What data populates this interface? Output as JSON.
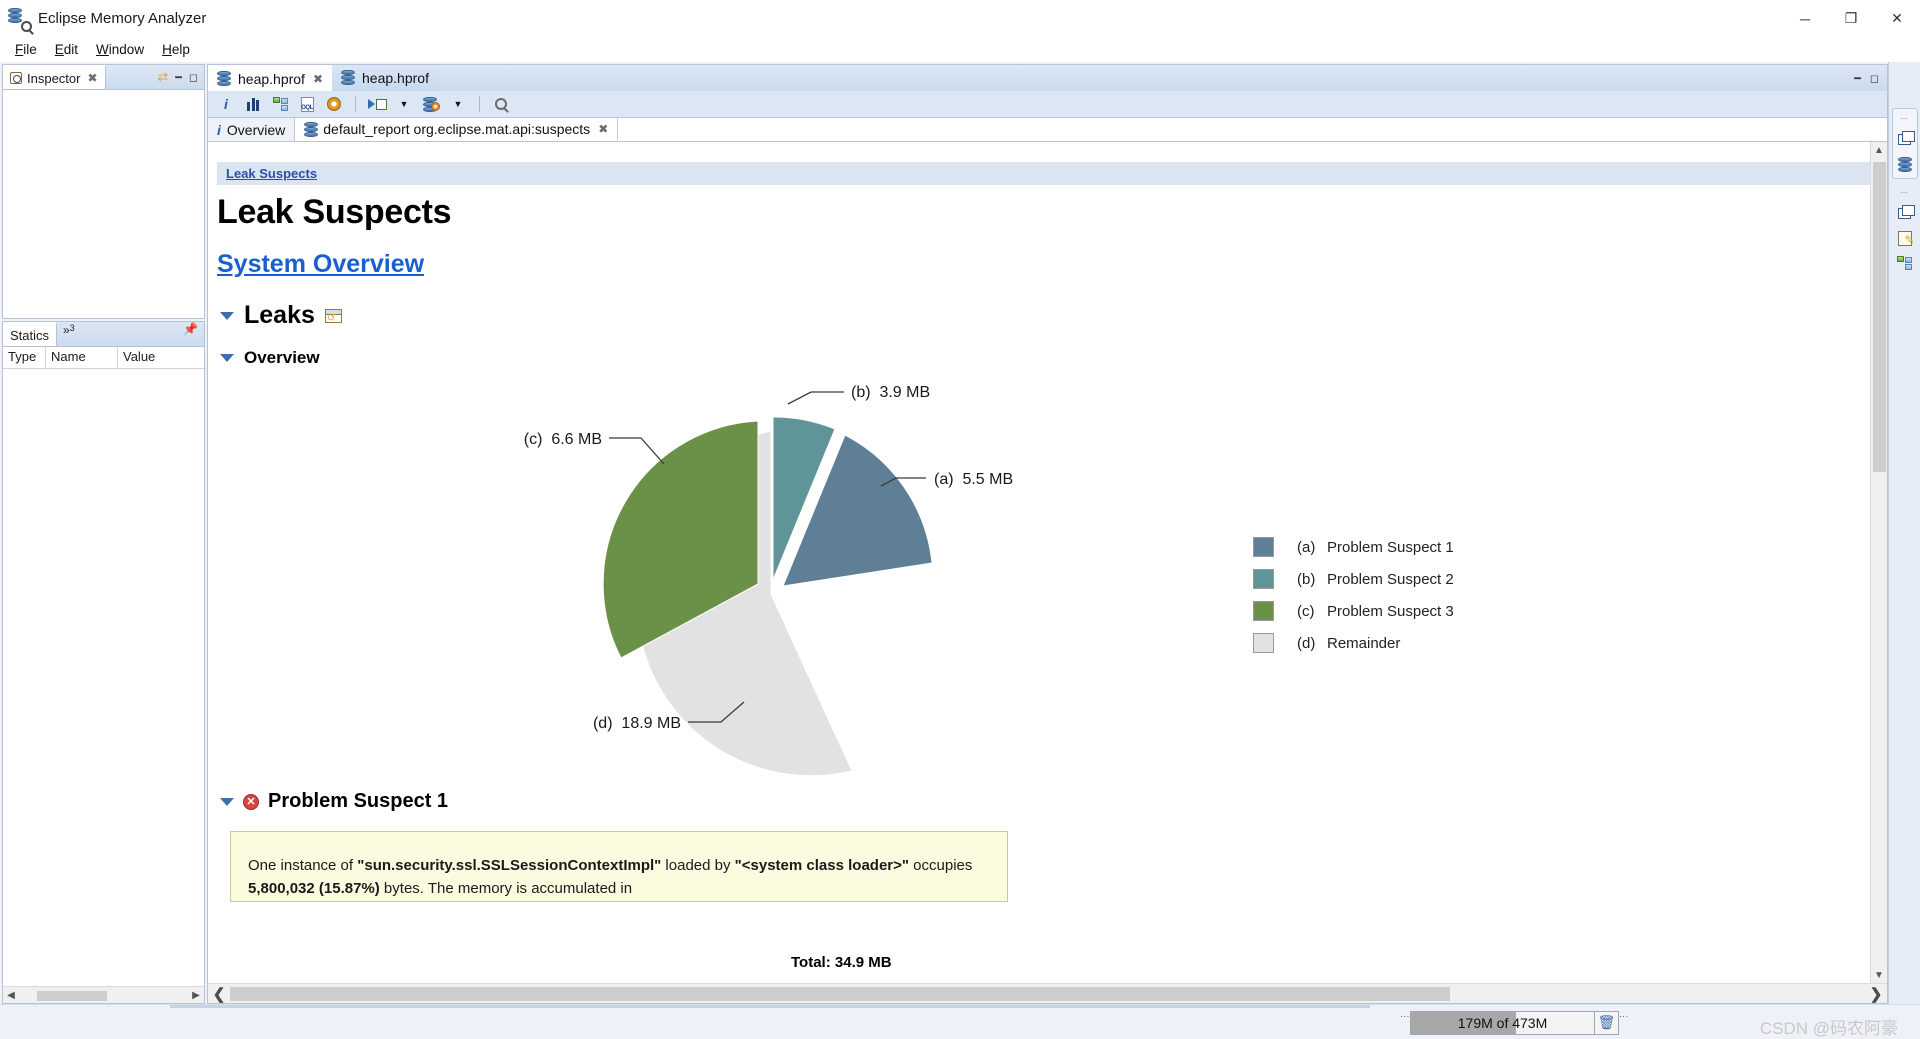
{
  "window": {
    "title": "Eclipse Memory Analyzer",
    "icon": "eclipse-mat-icon",
    "minimize": "─",
    "maximize": "❐",
    "close": "✕"
  },
  "menubar": {
    "items": [
      {
        "label": "File",
        "mnemonic": "F"
      },
      {
        "label": "Edit",
        "mnemonic": "E"
      },
      {
        "label": "Window",
        "mnemonic": "W"
      },
      {
        "label": "Help",
        "mnemonic": "H"
      }
    ]
  },
  "left_panel": {
    "inspector": {
      "tab_label": "Inspector",
      "close_glyph": "✖",
      "sync_icon": "sync-icon",
      "minimize_icon": "minimize-icon",
      "maximize_icon": "maximize-icon"
    },
    "statics": {
      "tab_label": "Statics",
      "more_label": "»",
      "more_count": "3",
      "pin_icon": "pin-icon",
      "columns": [
        "Type",
        "Name",
        "Value"
      ],
      "rows": []
    }
  },
  "editor": {
    "tabs": [
      {
        "label": "heap.hprof",
        "active": true,
        "close_glyph": "✖",
        "icon": "heap-dump-icon"
      },
      {
        "label": "heap.hprof",
        "active": false,
        "icon": "heap-dump-icon"
      }
    ],
    "tab_tools": {
      "minimize_icon": "minimize-icon",
      "maximize_icon": "maximize-icon"
    },
    "toolbar": [
      {
        "name": "overview-info-icon",
        "glyph": "i"
      },
      {
        "name": "histogram-icon",
        "glyph": "bars"
      },
      {
        "name": "dominator-tree-icon",
        "glyph": "tree"
      },
      {
        "name": "oql-icon",
        "glyph": "OQL"
      },
      {
        "name": "settings-gear-icon",
        "glyph": "gear"
      },
      {
        "name": "run-expert-system-icon",
        "glyph": "run"
      },
      {
        "name": "run-dropdown-caret",
        "glyph": "▼"
      },
      {
        "name": "query-browser-icon",
        "glyph": "querydb"
      },
      {
        "name": "query-dropdown-caret",
        "glyph": "▼"
      },
      {
        "name": "search-icon",
        "glyph": "search"
      }
    ],
    "page_tabs": [
      {
        "label": "Overview",
        "icon": "info-icon",
        "selected": false
      },
      {
        "label": "default_report org.eclipse.mat.api:suspects",
        "icon": "report-icon",
        "selected": true,
        "close_glyph": "✖"
      }
    ]
  },
  "report": {
    "breadcrumb": "Leak Suspects",
    "heading": "Leak Suspects",
    "system_overview_link": "System Overview",
    "sections": {
      "leaks": {
        "title": "Leaks",
        "twisty": "expanded",
        "window_icon": "open-in-window-icon"
      },
      "overview": {
        "title": "Overview",
        "twisty": "expanded"
      }
    },
    "suspect": {
      "title": "Problem Suspect 1",
      "severity_icon": "error-icon",
      "twisty": "expanded",
      "text_line1_pre": "One instance of ",
      "text_line1_class": "\"sun.security.ssl.SSLSessionContextImpl\"",
      "text_line1_mid": " loaded by ",
      "text_line1_loader": "\"<system",
      "text_line2_loader": "class loader>\"",
      "text_line2_mid": " occupies ",
      "text_line2_bytes": "5,800,032 (15.87%)",
      "text_line2_post": " bytes. The memory is accumulated in"
    }
  },
  "chart_data": {
    "type": "pie",
    "title": "",
    "total_label": "Total: 34.9 MB",
    "total_value": 34.9,
    "unit": "MB",
    "legend_position": "right",
    "categories": [
      "(a) Problem Suspect 1",
      "(b) Problem Suspect 2",
      "(c) Problem Suspect 3",
      "(d) Remainder"
    ],
    "keys": [
      "(a)",
      "(b)",
      "(c)",
      "(d)"
    ],
    "labels": [
      "Problem Suspect 1",
      "Problem Suspect 2",
      "Problem Suspect 3",
      "Remainder"
    ],
    "values": [
      5.5,
      3.9,
      6.6,
      18.9
    ],
    "value_labels": [
      "5.5 MB",
      "3.9 MB",
      "6.6 MB",
      "18.9 MB"
    ],
    "callout_labels": [
      {
        "key": "(a)",
        "value": "5.5 MB"
      },
      {
        "key": "(b)",
        "value": "3.9 MB"
      },
      {
        "key": "(c)",
        "value": "6.6 MB"
      },
      {
        "key": "(d)",
        "value": "18.9 MB"
      }
    ],
    "colors": [
      "#5f7f96",
      "#5f9499",
      "#6b9148",
      "#e0e0e0"
    ],
    "exploded": [
      true,
      true,
      true,
      false
    ]
  },
  "right_bar": {
    "groups": [
      {
        "dots": "····",
        "icons": [
          "restore-icon",
          "heap-dump-icon"
        ]
      },
      {
        "dots": "····",
        "icons": [
          "restore-icon",
          "edit-icon",
          "dominator-tree-icon"
        ]
      }
    ]
  },
  "statusbar": {
    "heap_used": "179M",
    "heap_separator": " of ",
    "heap_total": "473M",
    "heap_text": "179M of 473M",
    "heap_percent": 38,
    "gc_icon": "trash-icon",
    "watermark": "CSDN @码农阿豪"
  }
}
